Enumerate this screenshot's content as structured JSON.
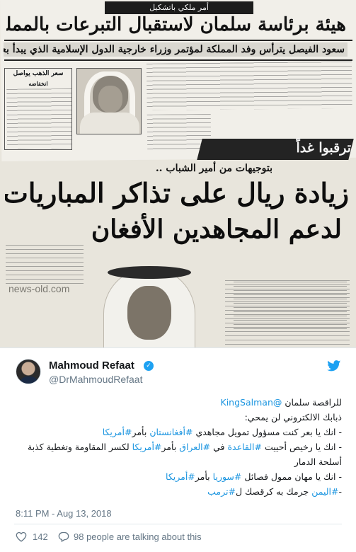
{
  "image": {
    "masthead": "أمر ملكي باتشكيل",
    "headline_1": "هيئة برئاسة سلمان لاستقبال التبرعات بالمملكة للمجاهدين الأفغان",
    "headline_2": "سعود الفيصل يترأس وفد المملكة لمؤتمر وزراء خارجية الدول الإسلامية الذي يبدأ بعد غد",
    "sidebox_title": "سعر الذهب يواصل",
    "sidebox_subtitle": "انخفاضه",
    "banner": "ترقبوا غداً",
    "kicker": "بتوجيهات من أمير الشباب ..",
    "headline_3": "زيادة ريال على تذاكر المباريات",
    "headline_4": "لدعم المجاهدين الأفغان",
    "watermark": "news-old.com"
  },
  "author": {
    "name": "Mahmoud Refaat",
    "handle": "@DrMahmoudRefaat",
    "verified_glyph": "✓"
  },
  "tweet": {
    "line_1_prefix": "للراقصة سلمان",
    "line_1_mention": "@KingSalman",
    "line_2": "ذبابك الالكتروني لن يمحي:",
    "line_3_a": "- انك يا بعر كنت مسؤول تمويل مجاهدي",
    "line_3_tag1": "#أفغانستان",
    "line_3_b": "بأمر",
    "line_3_tag2": "#أمريكا",
    "line_4_a": "- انك يا رخيص أحييت",
    "line_4_tag1": "#القاعدة",
    "line_4_b": "في",
    "line_4_tag2": "#العراق",
    "line_4_c": "بأمر",
    "line_4_tag3": "#أمريكا",
    "line_4_d": "لكسر المقاومة وتغطية كذبة أسلحة الدمار",
    "line_5_a": "- انك يا مهان ممول فصائل",
    "line_5_tag1": "#سوريا",
    "line_5_b": "بأمر",
    "line_5_tag2": "#أمريكا",
    "line_6_a": "-",
    "line_6_tag1": "#اليمن",
    "line_6_b": "جرمك به كرقصك ل",
    "line_6_tag2": "#ترمب"
  },
  "footer": {
    "timestamp": "8:11 PM - Aug 13, 2018",
    "like_count": "142",
    "talking_text": "98 people are talking about this"
  },
  "colors": {
    "link": "#1b95e0",
    "twitter_blue": "#1da1f2",
    "secondary_text": "#657786",
    "like_red": "#e0245e"
  },
  "icons": [
    "verified-badge-icon",
    "twitter-bird-icon",
    "heart-icon",
    "speech-bubble-icon"
  ]
}
